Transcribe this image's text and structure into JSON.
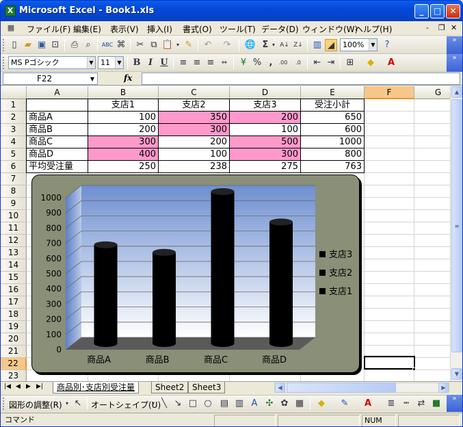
{
  "window": {
    "title": "Microsoft Excel - Book1.xls",
    "app_icon": "excel-icon"
  },
  "menu": [
    "ファイル(F)",
    "編集(E)",
    "表示(V)",
    "挿入(I)",
    "書式(O)",
    "ツール(T)",
    "データ(D)",
    "ウィンドウ(W)",
    "ヘルプ(H)"
  ],
  "toolbar": {
    "zoom": "100%",
    "font": "MS Pゴシック",
    "size": "11"
  },
  "formula_bar": {
    "cell_ref": "F22",
    "fx": "fx",
    "content": ""
  },
  "columns": [
    "A",
    "B",
    "C",
    "D",
    "E",
    "F",
    "G"
  ],
  "rows": [
    "1",
    "2",
    "3",
    "4",
    "5",
    "6",
    "7",
    "8",
    "9",
    "10",
    "11",
    "12",
    "13",
    "14",
    "15",
    "16",
    "17",
    "18",
    "19",
    "20",
    "21",
    "22",
    "23"
  ],
  "table": {
    "header": [
      "",
      "支店1",
      "支店2",
      "支店3",
      "受注小計"
    ],
    "rows": [
      [
        "商品A",
        "100",
        "350",
        "200",
        "650"
      ],
      [
        "商品B",
        "200",
        "300",
        "100",
        "600"
      ],
      [
        "商品C",
        "300",
        "200",
        "500",
        "1000"
      ],
      [
        "商品D",
        "400",
        "100",
        "300",
        "800"
      ],
      [
        "平均受注量",
        "250",
        "238",
        "275",
        "763"
      ]
    ],
    "highlight_color": "#FF99CC"
  },
  "chart_data": {
    "type": "bar",
    "stacked": true,
    "categories": [
      "商品A",
      "商品B",
      "商品C",
      "商品D"
    ],
    "series": [
      {
        "name": "支店1",
        "values": [
          100,
          200,
          300,
          400
        ]
      },
      {
        "name": "支店2",
        "values": [
          350,
          300,
          200,
          100
        ]
      },
      {
        "name": "支店3",
        "values": [
          200,
          100,
          500,
          300
        ]
      }
    ],
    "totals": [
      650,
      600,
      1000,
      800
    ],
    "ylim": [
      0,
      1000
    ],
    "yticks": [
      "0",
      "100",
      "200",
      "300",
      "400",
      "500",
      "600",
      "700",
      "800",
      "900",
      "1000"
    ],
    "legend": [
      "支店3",
      "支店2",
      "支店1"
    ],
    "legend_position": "right",
    "grid": true,
    "bar_color": "#000000",
    "plot_background": "#6E8FD0",
    "chart_background": "#8A8F78"
  },
  "sheets": [
    "商品別･支店別受注量",
    "Sheet2",
    "Sheet3"
  ],
  "drawing_toolbar": {
    "adjust": "図形の調整(R)",
    "autoshape": "オートシェイプ(U)"
  },
  "status": {
    "mode": "コマンド",
    "num": "NUM"
  }
}
